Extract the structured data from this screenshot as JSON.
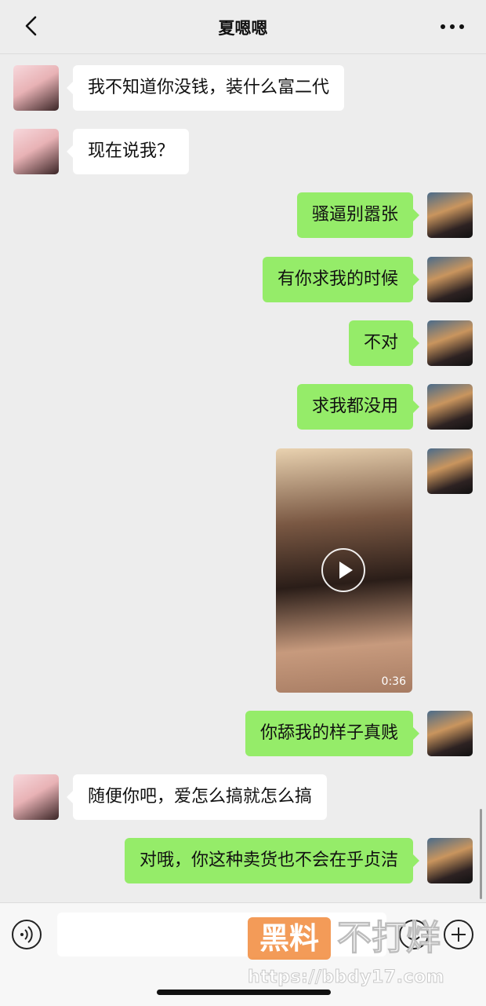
{
  "header": {
    "title": "夏嗯嗯",
    "back_icon": "chevron-left-icon",
    "more_icon": "more-dots-icon"
  },
  "messages": [
    {
      "from": "her",
      "text": "我不知道你没钱，装什么富二代"
    },
    {
      "from": "her",
      "text": "现在说我？"
    },
    {
      "from": "me",
      "text": "骚逼别嚣张"
    },
    {
      "from": "me",
      "text": "有你求我的时候"
    },
    {
      "from": "me",
      "text": "不对"
    },
    {
      "from": "me",
      "text": "求我都没用"
    },
    {
      "from": "me",
      "type": "video",
      "duration": "0:36"
    },
    {
      "from": "me",
      "text": "你舔我的样子真贱"
    },
    {
      "from": "her",
      "text": "随便你吧，爱怎么搞就怎么搞"
    },
    {
      "from": "me",
      "text": "对哦，你这种卖货也不会在乎贞洁"
    }
  ],
  "input_bar": {
    "text_value": "",
    "voice_icon": "voice-icon",
    "emoji_icon": "emoji-icon",
    "plus_icon": "plus-icon"
  },
  "watermark": {
    "logo_text": "黑料",
    "text": "不打烊",
    "url": "https://bbdy17.com"
  }
}
